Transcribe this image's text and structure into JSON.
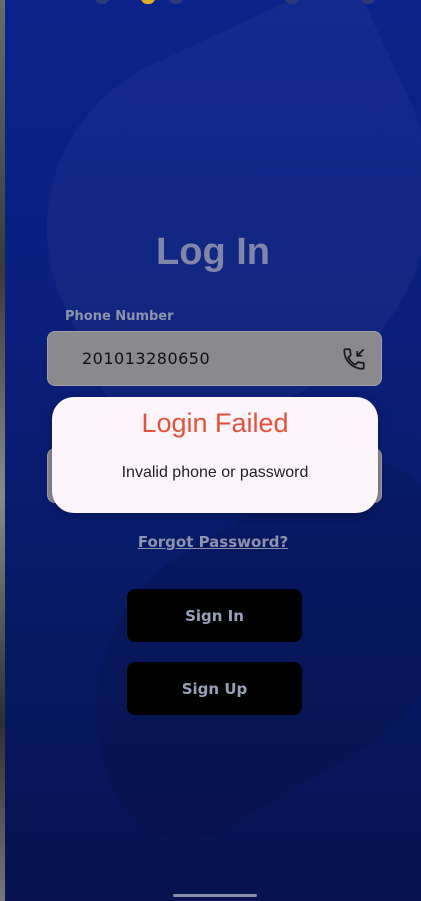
{
  "login": {
    "title": "Log In",
    "phone_label": "Phone Number",
    "phone_value": "201013280650",
    "forgot_password": "Forgot Password?",
    "sign_in": "Sign In",
    "sign_up": "Sign Up"
  },
  "dialog": {
    "title": "Login Failed",
    "message": "Invalid phone or password"
  },
  "colors": {
    "background": "#0a1f7d",
    "dialog_title": "#e8503a",
    "button": "#000000"
  },
  "icons": {
    "phone_field_icon": "phone-incoming-icon"
  }
}
